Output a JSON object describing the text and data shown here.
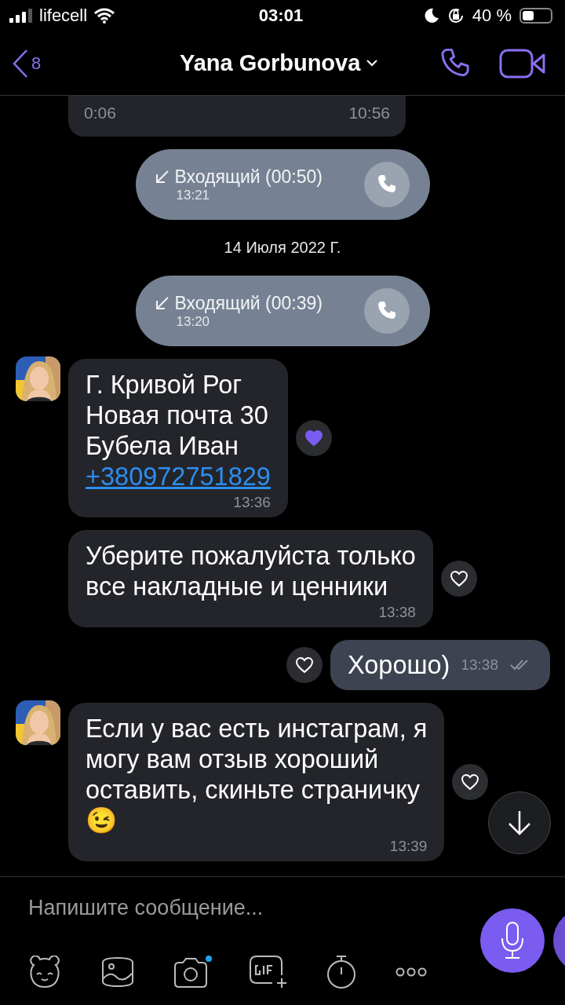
{
  "status_bar": {
    "carrier": "lifecell",
    "time": "03:01",
    "battery": "40 %"
  },
  "header": {
    "back_count": "8",
    "title": "Yana Gorbunova"
  },
  "messages": [
    {
      "kind": "voice_partial",
      "duration": "0:06",
      "time": "10:56"
    },
    {
      "kind": "call",
      "label": "Входящий (00:50)",
      "time": "13:21"
    },
    {
      "kind": "date",
      "text": "14 Июля 2022 Г."
    },
    {
      "kind": "call",
      "label": "Входящий (00:39)",
      "time": "13:20"
    },
    {
      "kind": "incoming",
      "avatar": true,
      "text": "Г. Кривой Рог\nНовая почта 30\nБубела Иван",
      "link": "+380972751829",
      "time": "13:36",
      "liked": true
    },
    {
      "kind": "incoming",
      "avatar": false,
      "text": "Уберите пожалуйста только\nвсе накладные и ценники",
      "time": "13:38",
      "liked": false
    },
    {
      "kind": "outgoing",
      "text": "Хорошо)",
      "time": "13:38",
      "liked": false
    },
    {
      "kind": "incoming",
      "avatar": true,
      "text": "Если у вас есть инстаграм, я\nмогу вам отзыв хороший\nоставить, скиньте страничку\n😉",
      "time": "13:39",
      "liked": false
    }
  ],
  "composer": {
    "placeholder": "Напишите сообщение..."
  }
}
